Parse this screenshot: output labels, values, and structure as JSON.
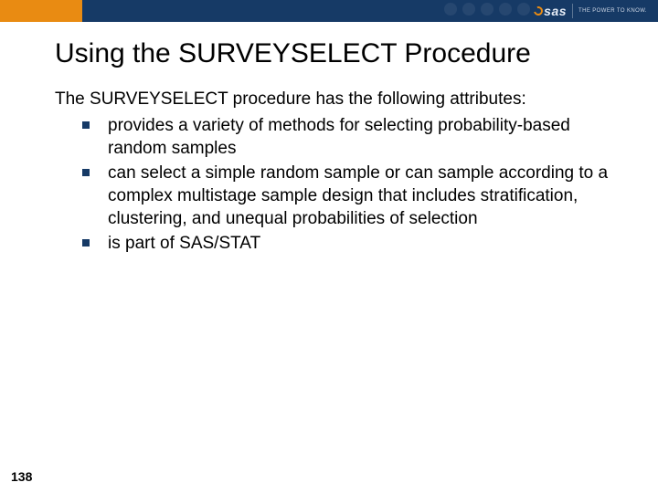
{
  "brand": {
    "name": "sas",
    "tagline": "THE POWER TO KNOW."
  },
  "title": "Using the SURVEYSELECT Procedure",
  "intro": "The SURVEYSELECT procedure has the following attributes:",
  "bullets": [
    "provides a variety of methods for selecting probability-based random samples",
    "can select a simple random sample or can sample according to a complex multistage sample design that includes stratification, clustering, and unequal probabilities of selection",
    "is part of SAS/STAT"
  ],
  "page_number": "138"
}
